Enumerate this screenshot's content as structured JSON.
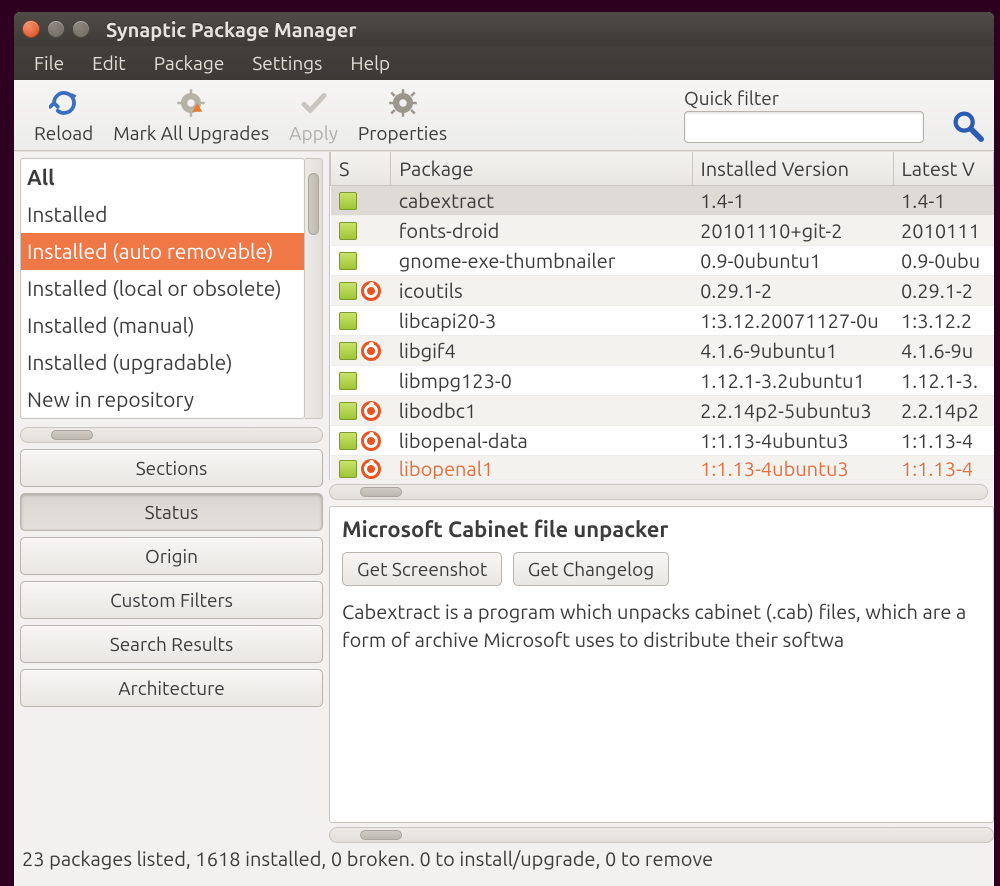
{
  "window": {
    "title": "Synaptic Package Manager"
  },
  "menu": {
    "items": [
      "File",
      "Edit",
      "Package",
      "Settings",
      "Help"
    ]
  },
  "toolbar": {
    "reload": "Reload",
    "mark_all": "Mark All Upgrades",
    "apply": "Apply",
    "properties": "Properties",
    "quick_filter_label": "Quick filter",
    "quick_filter_value": ""
  },
  "sidebar": {
    "filters": [
      "All",
      "Installed",
      "Installed (auto removable)",
      "Installed (local or obsolete)",
      "Installed (manual)",
      "Installed (upgradable)",
      "New in repository"
    ],
    "selected_index": 2,
    "buttons": {
      "sections": "Sections",
      "status": "Status",
      "origin": "Origin",
      "custom_filters": "Custom Filters",
      "search_results": "Search Results",
      "architecture": "Architecture"
    },
    "active_button": "status"
  },
  "table": {
    "headers": {
      "s": "S",
      "package": "Package",
      "installed": "Installed Version",
      "latest": "Latest V"
    },
    "selected_row": 0,
    "rows": [
      {
        "ubuntu": false,
        "name": "cabextract",
        "installed": "1.4-1",
        "latest": "1.4-1"
      },
      {
        "ubuntu": false,
        "name": "fonts-droid",
        "installed": "20101110+git-2",
        "latest": "2010111"
      },
      {
        "ubuntu": false,
        "name": "gnome-exe-thumbnailer",
        "installed": "0.9-0ubuntu1",
        "latest": "0.9-0ubu"
      },
      {
        "ubuntu": true,
        "name": "icoutils",
        "installed": "0.29.1-2",
        "latest": "0.29.1-2"
      },
      {
        "ubuntu": false,
        "name": "libcapi20-3",
        "installed": "1:3.12.20071127-0u",
        "latest": "1:3.12.2"
      },
      {
        "ubuntu": true,
        "name": "libgif4",
        "installed": "4.1.6-9ubuntu1",
        "latest": "4.1.6-9u"
      },
      {
        "ubuntu": false,
        "name": "libmpg123-0",
        "installed": "1.12.1-3.2ubuntu1",
        "latest": "1.12.1-3."
      },
      {
        "ubuntu": true,
        "name": "libodbc1",
        "installed": "2.2.14p2-5ubuntu3",
        "latest": "2.2.14p2"
      },
      {
        "ubuntu": true,
        "name": "libopenal-data",
        "installed": "1:1.13-4ubuntu3",
        "latest": "1:1.13-4"
      },
      {
        "ubuntu": true,
        "name": "libopenal1",
        "installed": "1:1.13-4ubuntu3",
        "latest": "1:1.13-4"
      }
    ]
  },
  "detail": {
    "title": "Microsoft Cabinet file unpacker",
    "get_screenshot": "Get Screenshot",
    "get_changelog": "Get Changelog",
    "description": "Cabextract is a program which unpacks cabinet (.cab) files, which are a form of archive Microsoft uses to distribute their softwa"
  },
  "status": "23 packages listed, 1618 installed, 0 broken. 0 to install/upgrade, 0 to remove"
}
